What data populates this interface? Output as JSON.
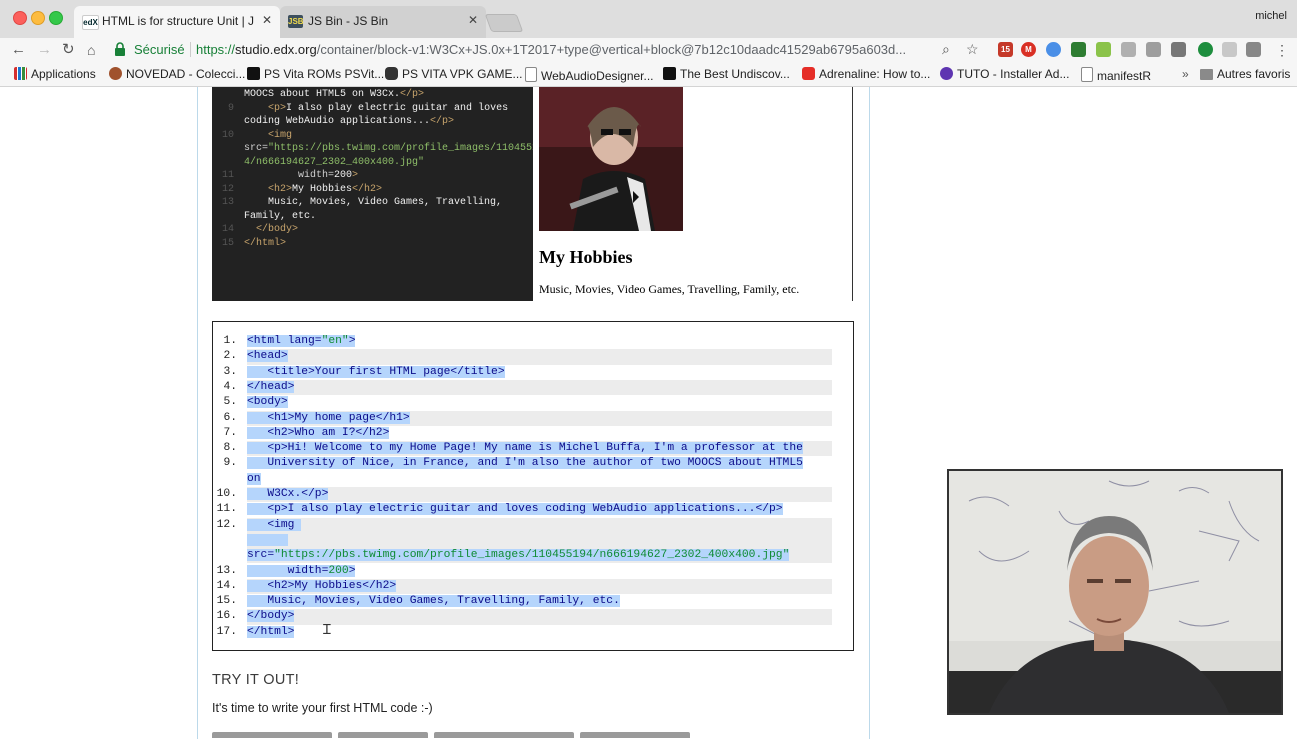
{
  "browser": {
    "user_name": "michel",
    "tabs": [
      {
        "label": "HTML is for structure Unit | Ja",
        "favicon": "edX"
      },
      {
        "label": "JS Bin - JS Bin",
        "favicon": "JSB"
      }
    ],
    "secure_label": "Sécurisé",
    "url_scheme": "https://",
    "url_host": "studio.edx.org",
    "url_path": "/container/block-v1:W3Cx+JS.0x+1T2017+type@vertical+block@7b12c10daadc41529ab6795a603d...",
    "bookmarks": [
      {
        "label": "Applications",
        "icon": "apps-grid-icon"
      },
      {
        "label": "NOVEDAD - Colecci...",
        "icon": "hand-icon"
      },
      {
        "label": "PS Vita ROMs PSVit...",
        "icon": "ps-icon"
      },
      {
        "label": "PS VITA VPK GAME...",
        "icon": "gamepad-icon"
      },
      {
        "label": "WebAudioDesigner...",
        "icon": "page-icon"
      },
      {
        "label": "The Best Undiscov...",
        "icon": "square-icon"
      },
      {
        "label": "Adrenaline: How to...",
        "icon": "youtube-icon"
      },
      {
        "label": "TUTO - Installer Ad...",
        "icon": "circle-icon"
      },
      {
        "label": "manifestR",
        "icon": "page-icon"
      }
    ],
    "bookmarks_overflow": "»",
    "other_bookmarks": "Autres favoris",
    "extension_badge": "15"
  },
  "preview": {
    "code_lines": [
      {
        "num": "",
        "parts": [
          {
            "t": "MOOCS about HTML5 on W3Cx.",
            "c": ""
          },
          {
            "t": "</p>",
            "c": "tagc"
          }
        ]
      },
      {
        "num": "9",
        "parts": [
          {
            "t": "    ",
            "c": ""
          },
          {
            "t": "<p>",
            "c": "tagc"
          },
          {
            "t": "I also play electric guitar and loves",
            "c": ""
          }
        ]
      },
      {
        "num": "",
        "parts": [
          {
            "t": "coding WebAudio applications...",
            "c": ""
          },
          {
            "t": "</p>",
            "c": "tagc"
          }
        ]
      },
      {
        "num": "10",
        "parts": [
          {
            "t": "    ",
            "c": ""
          },
          {
            "t": "<img",
            "c": "tagc"
          }
        ]
      },
      {
        "num": "",
        "parts": [
          {
            "t": "src=",
            "c": "attrc"
          },
          {
            "t": "\"https://pbs.twimg.com/profile_images/11045519",
            "c": "strc"
          }
        ]
      },
      {
        "num": "",
        "parts": [
          {
            "t": "4/n666194627_2302_400x400.jpg\"",
            "c": "strc"
          }
        ]
      },
      {
        "num": "11",
        "parts": [
          {
            "t": "         width=",
            "c": "attrc"
          },
          {
            "t": "200",
            "c": ""
          },
          {
            "t": ">",
            "c": "tagc"
          }
        ]
      },
      {
        "num": "12",
        "parts": [
          {
            "t": "    ",
            "c": ""
          },
          {
            "t": "<h2>",
            "c": "tagc"
          },
          {
            "t": "My Hobbies",
            "c": ""
          },
          {
            "t": "</h2>",
            "c": "tagc"
          }
        ]
      },
      {
        "num": "13",
        "parts": [
          {
            "t": "    Music, Movies, Video Games, Travelling,",
            "c": ""
          }
        ]
      },
      {
        "num": "",
        "parts": [
          {
            "t": "Family, etc.",
            "c": ""
          }
        ]
      },
      {
        "num": "14",
        "parts": [
          {
            "t": "  ",
            "c": ""
          },
          {
            "t": "</body>",
            "c": "tagc"
          }
        ]
      },
      {
        "num": "15",
        "parts": [
          {
            "t": "</html>",
            "c": "tagc"
          }
        ]
      }
    ],
    "render_heading": "My Hobbies",
    "render_text": "Music, Movies, Video Games, Travelling, Family, etc."
  },
  "listing": [
    {
      "num": "1.",
      "parts": [
        {
          "t": "<html lang=",
          "c": "k"
        },
        {
          "t": "\"en\"",
          "c": "s"
        },
        {
          "t": ">",
          "c": "k"
        }
      ],
      "shade": false
    },
    {
      "num": "2.",
      "parts": [
        {
          "t": "<head>",
          "c": "k"
        }
      ],
      "shade": true
    },
    {
      "num": "3.",
      "parts": [
        {
          "t": "   <title>Your first HTML page</title>",
          "c": "k"
        }
      ],
      "shade": false
    },
    {
      "num": "4.",
      "parts": [
        {
          "t": "</head>",
          "c": "k"
        }
      ],
      "shade": true
    },
    {
      "num": "5.",
      "parts": [
        {
          "t": "<body>",
          "c": "k"
        }
      ],
      "shade": false
    },
    {
      "num": "6.",
      "parts": [
        {
          "t": "   <h1>My home page</h1>",
          "c": "k"
        }
      ],
      "shade": true
    },
    {
      "num": "7.",
      "parts": [
        {
          "t": "   <h2>Who am I?</h2>",
          "c": "k"
        }
      ],
      "shade": false
    },
    {
      "num": "8.",
      "parts": [
        {
          "t": "   <p>Hi! Welcome to my Home Page! My name is Michel Buffa, I'm a professor at the",
          "c": "k"
        }
      ],
      "shade": true
    },
    {
      "num": "9.",
      "parts": [
        {
          "t": "   University of Nice, in France, and I'm also the author of two MOOCS about HTML5",
          "c": "k"
        }
      ],
      "shade": false
    },
    {
      "num": "",
      "parts": [
        {
          "t": "on",
          "c": "k"
        }
      ],
      "shade": false
    },
    {
      "num": "10.",
      "parts": [
        {
          "t": "   W3Cx.</p>",
          "c": "k"
        }
      ],
      "shade": true
    },
    {
      "num": "11.",
      "parts": [
        {
          "t": "   <p>I also play electric guitar and loves coding WebAudio applications...</p>",
          "c": "k"
        }
      ],
      "shade": false
    },
    {
      "num": "12.",
      "parts": [
        {
          "t": "   <img ",
          "c": "k"
        }
      ],
      "shade": true
    },
    {
      "num": "",
      "parts": [
        {
          "t": "      ",
          "c": "k"
        }
      ],
      "shade": true
    },
    {
      "num": "",
      "parts": [
        {
          "t": "src=",
          "c": "k"
        },
        {
          "t": "\"https://pbs.twimg.com/profile_images/110455194/n666194627_2302_400x400.jpg\"",
          "c": "s"
        }
      ],
      "shade": true
    },
    {
      "num": "13.",
      "parts": [
        {
          "t": "      width=",
          "c": "k"
        },
        {
          "t": "200",
          "c": "s"
        },
        {
          "t": ">",
          "c": "k"
        }
      ],
      "shade": false
    },
    {
      "num": "14.",
      "parts": [
        {
          "t": "   <h2>My Hobbies</h2>",
          "c": "k"
        }
      ],
      "shade": true
    },
    {
      "num": "15.",
      "parts": [
        {
          "t": "   Music, Movies, Video Games, Travelling, Family, etc.",
          "c": "k"
        }
      ],
      "shade": false
    },
    {
      "num": "16.",
      "parts": [
        {
          "t": "</body>",
          "c": "k"
        }
      ],
      "shade": true
    },
    {
      "num": "17.",
      "parts": [
        {
          "t": "</html>",
          "c": "k"
        }
      ],
      "shade": false
    }
  ],
  "try_it": {
    "heading": "TRY IT OUT!",
    "text": "It's time to write your first HTML code :-)"
  },
  "colors": {
    "selection": "#b5d5fc",
    "code_bg": "#222222",
    "secure_green": "#188038"
  }
}
